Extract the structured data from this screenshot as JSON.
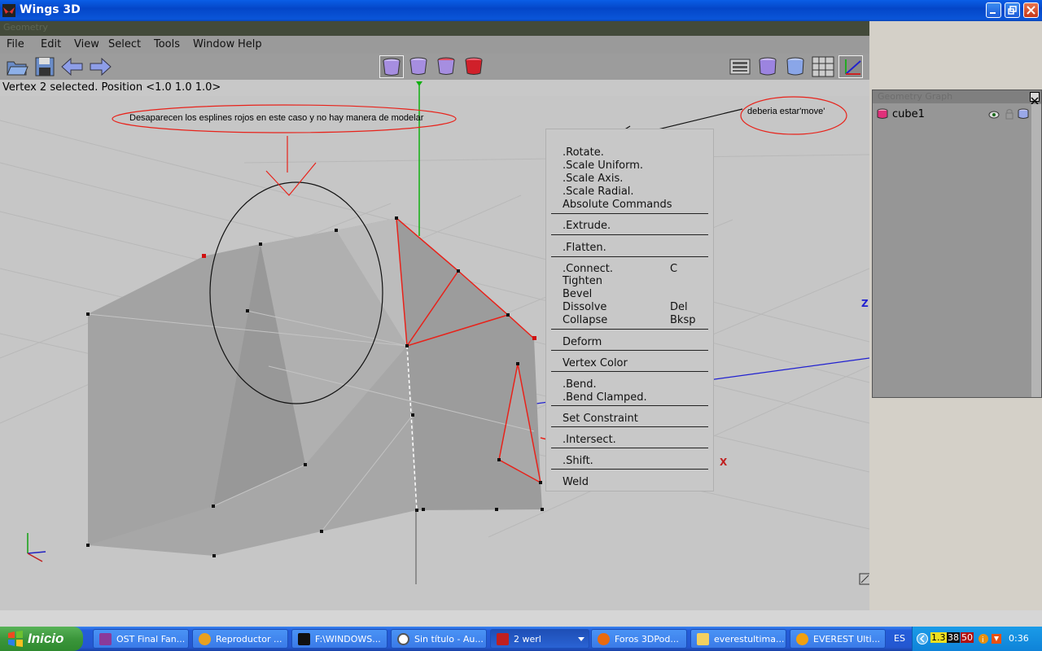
{
  "window": {
    "title": "Wings 3D"
  },
  "geometry_strip": {
    "label": "Geometry"
  },
  "menu": [
    "File",
    "Edit",
    "View",
    "Select",
    "Tools",
    "Window",
    "Help"
  ],
  "status": "Vertex 2 selected. Position <1.0  1.0  1.0>",
  "annotations": {
    "note1": "Desaparecen los esplines rojos en este caso y no hay manera de modelar",
    "note2": "deberia estar'move'"
  },
  "axis_labels": {
    "z": "Z",
    "x": "X"
  },
  "context_menu": {
    "items": [
      {
        "label": ".Rotate.",
        "hotkey": ""
      },
      {
        "label": ".Scale Uniform.",
        "hotkey": ""
      },
      {
        "label": ".Scale Axis.",
        "hotkey": ""
      },
      {
        "label": ".Scale Radial.",
        "hotkey": ""
      },
      {
        "label": "Absolute Commands",
        "hotkey": ""
      },
      {
        "label": ".Extrude.",
        "hotkey": ""
      },
      {
        "label": ".Flatten.",
        "hotkey": ""
      },
      {
        "label": ".Connect.",
        "hotkey": "C"
      },
      {
        "label": "Tighten",
        "hotkey": ""
      },
      {
        "label": "Bevel",
        "hotkey": ""
      },
      {
        "label": "Dissolve",
        "hotkey": "Del"
      },
      {
        "label": "Collapse",
        "hotkey": "Bksp"
      },
      {
        "label": "Deform",
        "hotkey": ""
      },
      {
        "label": "Vertex Color",
        "hotkey": ""
      },
      {
        "label": ".Bend.",
        "hotkey": ""
      },
      {
        "label": ".Bend Clamped.",
        "hotkey": ""
      },
      {
        "label": "Set Constraint",
        "hotkey": ""
      },
      {
        "label": ".Intersect.",
        "hotkey": ""
      },
      {
        "label": ".Shift.",
        "hotkey": ""
      },
      {
        "label": "Weld",
        "hotkey": ""
      }
    ]
  },
  "geometry_panel": {
    "title": "Geometry Graph",
    "object": "cube1"
  },
  "taskbar": {
    "start": "Inicio",
    "tasks": [
      "OST Final Fan...",
      "Reproductor ...",
      "F:\\WINDOWS...",
      "Sin título - Au...",
      "2 werl",
      "Foros 3DPod...",
      "everestultima...",
      "EVEREST Ulti..."
    ],
    "lang": "ES",
    "tray_nums": [
      "1.3",
      "38",
      "50"
    ],
    "clock": "0:36"
  },
  "colors": {
    "title_blue": "#0a5ee6",
    "start_green": "#3b963b",
    "red_edges": "#e8221a"
  }
}
